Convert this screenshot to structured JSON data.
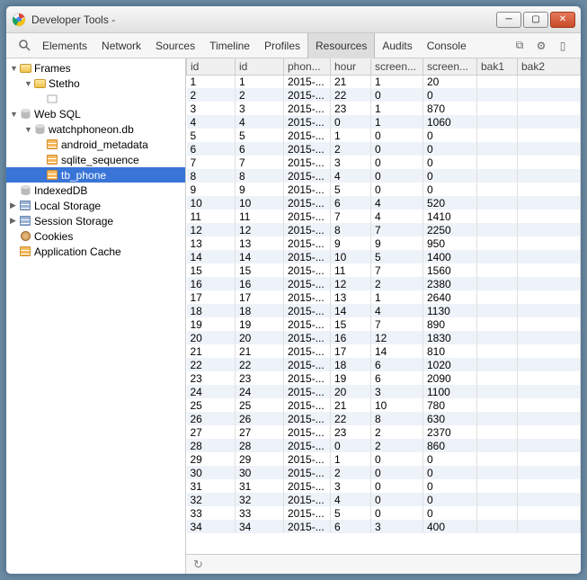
{
  "window": {
    "title": "Developer Tools -"
  },
  "tabs": {
    "elements": "Elements",
    "network": "Network",
    "sources": "Sources",
    "timeline": "Timeline",
    "profiles": "Profiles",
    "resources": "Resources",
    "audits": "Audits",
    "console": "Console"
  },
  "sidebar": {
    "frames": "Frames",
    "stetho": "Stetho",
    "websql": "Web SQL",
    "db": "watchphoneon.db",
    "t1": "android_metadata",
    "t2": "sqlite_sequence",
    "t3": "tb_phone",
    "indexeddb": "IndexedDB",
    "localstorage": "Local Storage",
    "sessionstorage": "Session Storage",
    "cookies": "Cookies",
    "appcache": "Application Cache"
  },
  "columns": [
    "id",
    "id",
    "phon...",
    "hour",
    "screen...",
    "screen...",
    "bak1",
    "bak2"
  ],
  "rows": [
    [
      "1",
      "1",
      "2015-...",
      "21",
      "1",
      "20",
      "",
      ""
    ],
    [
      "2",
      "2",
      "2015-...",
      "22",
      "0",
      "0",
      "",
      ""
    ],
    [
      "3",
      "3",
      "2015-...",
      "23",
      "1",
      "870",
      "",
      ""
    ],
    [
      "4",
      "4",
      "2015-...",
      "0",
      "1",
      "1060",
      "",
      ""
    ],
    [
      "5",
      "5",
      "2015-...",
      "1",
      "0",
      "0",
      "",
      ""
    ],
    [
      "6",
      "6",
      "2015-...",
      "2",
      "0",
      "0",
      "",
      ""
    ],
    [
      "7",
      "7",
      "2015-...",
      "3",
      "0",
      "0",
      "",
      ""
    ],
    [
      "8",
      "8",
      "2015-...",
      "4",
      "0",
      "0",
      "",
      ""
    ],
    [
      "9",
      "9",
      "2015-...",
      "5",
      "0",
      "0",
      "",
      ""
    ],
    [
      "10",
      "10",
      "2015-...",
      "6",
      "4",
      "520",
      "",
      ""
    ],
    [
      "11",
      "11",
      "2015-...",
      "7",
      "4",
      "1410",
      "",
      ""
    ],
    [
      "12",
      "12",
      "2015-...",
      "8",
      "7",
      "2250",
      "",
      ""
    ],
    [
      "13",
      "13",
      "2015-...",
      "9",
      "9",
      "950",
      "",
      ""
    ],
    [
      "14",
      "14",
      "2015-...",
      "10",
      "5",
      "1400",
      "",
      ""
    ],
    [
      "15",
      "15",
      "2015-...",
      "11",
      "7",
      "1560",
      "",
      ""
    ],
    [
      "16",
      "16",
      "2015-...",
      "12",
      "2",
      "2380",
      "",
      ""
    ],
    [
      "17",
      "17",
      "2015-...",
      "13",
      "1",
      "2640",
      "",
      ""
    ],
    [
      "18",
      "18",
      "2015-...",
      "14",
      "4",
      "1130",
      "",
      ""
    ],
    [
      "19",
      "19",
      "2015-...",
      "15",
      "7",
      "890",
      "",
      ""
    ],
    [
      "20",
      "20",
      "2015-...",
      "16",
      "12",
      "1830",
      "",
      ""
    ],
    [
      "21",
      "21",
      "2015-...",
      "17",
      "14",
      "810",
      "",
      ""
    ],
    [
      "22",
      "22",
      "2015-...",
      "18",
      "6",
      "1020",
      "",
      ""
    ],
    [
      "23",
      "23",
      "2015-...",
      "19",
      "6",
      "2090",
      "",
      ""
    ],
    [
      "24",
      "24",
      "2015-...",
      "20",
      "3",
      "1100",
      "",
      ""
    ],
    [
      "25",
      "25",
      "2015-...",
      "21",
      "10",
      "780",
      "",
      ""
    ],
    [
      "26",
      "26",
      "2015-...",
      "22",
      "8",
      "630",
      "",
      ""
    ],
    [
      "27",
      "27",
      "2015-...",
      "23",
      "2",
      "2370",
      "",
      ""
    ],
    [
      "28",
      "28",
      "2015-...",
      "0",
      "2",
      "860",
      "",
      ""
    ],
    [
      "29",
      "29",
      "2015-...",
      "1",
      "0",
      "0",
      "",
      ""
    ],
    [
      "30",
      "30",
      "2015-...",
      "2",
      "0",
      "0",
      "",
      ""
    ],
    [
      "31",
      "31",
      "2015-...",
      "3",
      "0",
      "0",
      "",
      ""
    ],
    [
      "32",
      "32",
      "2015-...",
      "4",
      "0",
      "0",
      "",
      ""
    ],
    [
      "33",
      "33",
      "2015-...",
      "5",
      "0",
      "0",
      "",
      ""
    ],
    [
      "34",
      "34",
      "2015-...",
      "6",
      "3",
      "400",
      "",
      ""
    ]
  ]
}
